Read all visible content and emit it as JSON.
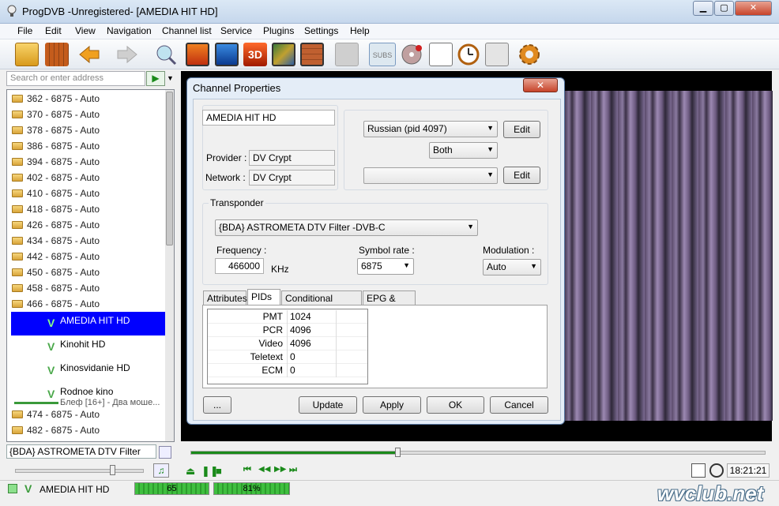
{
  "window": {
    "title": "ProgDVB -Unregistered-  [AMEDIA HIT HD]",
    "minimize": "▁",
    "maximize": "▢",
    "close": "✕"
  },
  "menu": [
    "File",
    "Edit",
    "View",
    "Navigation",
    "Channel list",
    "Service",
    "Plugins",
    "Settings",
    "Help"
  ],
  "toolbar": {
    "subs_label": "SUBS",
    "three_d_label": "3D"
  },
  "address": {
    "placeholder": "Search or enter address",
    "go": "▶",
    "dropdown": "▼"
  },
  "channel_list": {
    "transponders_top": [
      "362 - 6875 - Auto",
      "370 - 6875 - Auto",
      "378 - 6875 - Auto",
      "386 - 6875 - Auto",
      "394 - 6875 - Auto",
      "402 - 6875 - Auto",
      "410 - 6875 - Auto",
      "418 - 6875 - Auto",
      "426 - 6875 - Auto",
      "434 - 6875 - Auto",
      "442 - 6875 - Auto",
      "450 - 6875 - Auto",
      "458 - 6875 - Auto",
      "466 - 6875 - Auto"
    ],
    "channels": [
      {
        "name": "AMEDIA HIT HD",
        "selected": true
      },
      {
        "name": "Kinohit HD"
      },
      {
        "name": "Kinosvidanie HD"
      },
      {
        "name": "Rodnoe kino",
        "epg": "Блеф [16+] - Два моше..."
      }
    ],
    "transponders_bottom": [
      "474 - 6875 - Auto",
      "482 - 6875 - Auto"
    ],
    "channel_icon": "V"
  },
  "filter": {
    "device": "{BDA} ASTROMETA DTV Filter"
  },
  "dialog": {
    "title": "Channel Properties",
    "close": "✕",
    "channel_name": "AMEDIA HIT HD",
    "provider_label": "Provider :",
    "provider": "DV Crypt",
    "network_label": "Network :",
    "network": "DV Crypt",
    "audio": "Russian (pid 4097)",
    "audio_channel": "Both",
    "subtitle": "",
    "edit_button": "Edit",
    "transponder_label": "Transponder",
    "device": "{BDA} ASTROMETA DTV Filter -DVB-C",
    "frequency_label": "Frequency :",
    "frequency": "466000",
    "frequency_unit": "KHz",
    "symbol_rate_label": "Symbol rate :",
    "symbol_rate": "6875",
    "modulation_label": "Modulation :",
    "modulation": "Auto",
    "tabs": [
      "Attributes",
      "PIDs",
      "Conditional Access",
      "EPG & Logo"
    ],
    "active_tab": "PIDs",
    "pids": [
      {
        "name": "PMT",
        "value": "1024"
      },
      {
        "name": "PCR",
        "value": "4096"
      },
      {
        "name": "Video",
        "value": "4096"
      },
      {
        "name": "Teletext",
        "value": "0"
      },
      {
        "name": "ECM",
        "value": "0"
      }
    ],
    "buttons": {
      "more": "...",
      "update": "Update",
      "apply": "Apply",
      "ok": "OK",
      "cancel": "Cancel"
    }
  },
  "player": {
    "seek_fraction": 0.36,
    "volume_fraction": 0.74,
    "time": "18:21:21",
    "controls": [
      "⏏",
      "❚❚",
      "■",
      "⏮",
      "◀◀",
      "▶▶",
      "⏭"
    ]
  },
  "status": {
    "channel": "AMEDIA HIT HD",
    "signal_level": "65",
    "signal_quality": "81%"
  },
  "watermark": "wvclub.net",
  "colors": {
    "selection": "#0000ff",
    "accent_green": "#1a8a1a"
  }
}
